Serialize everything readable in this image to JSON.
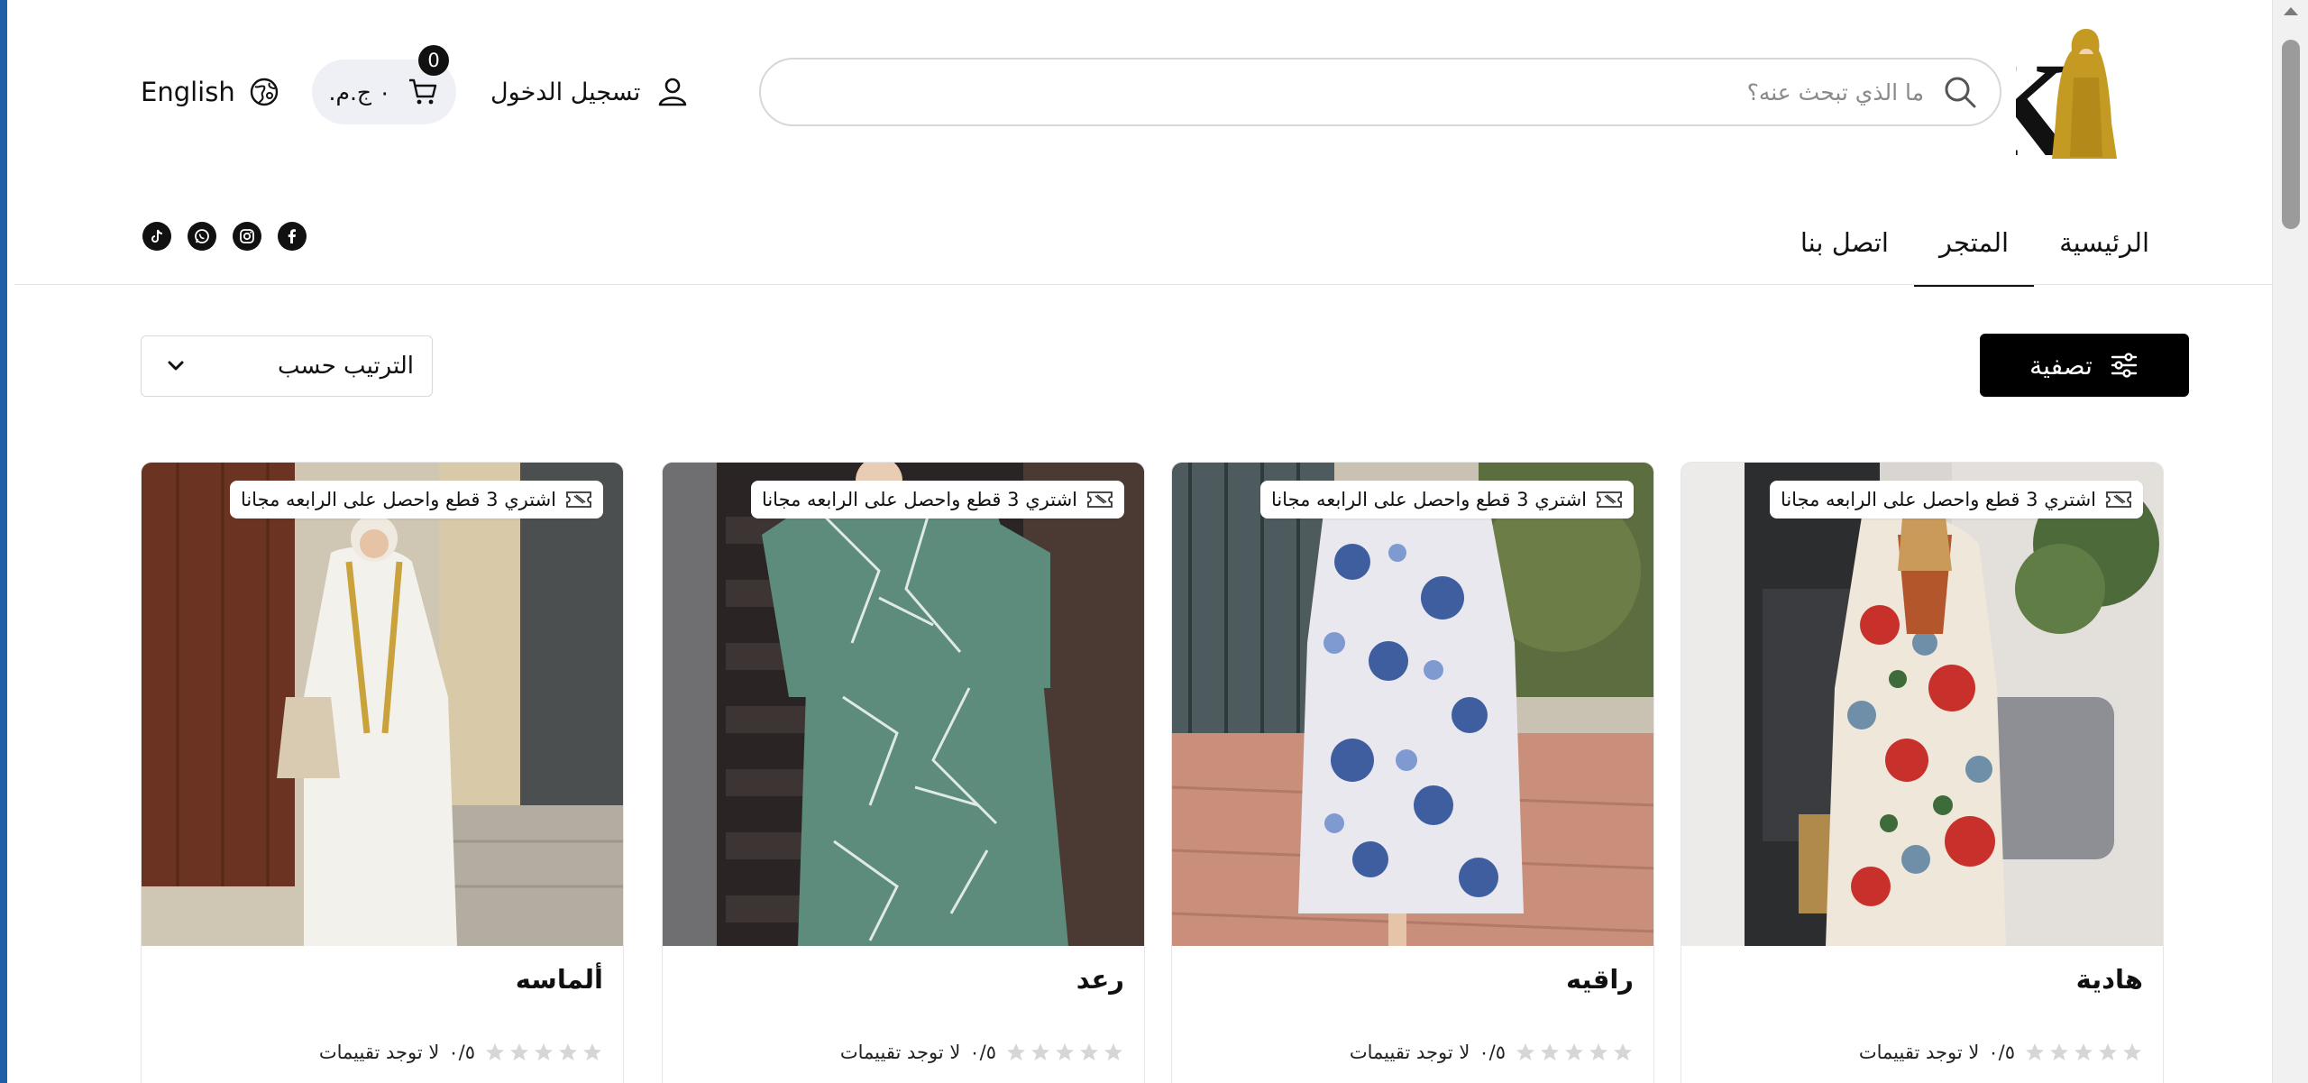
{
  "header": {
    "search_placeholder": "ما الذي تبحث عنه؟",
    "login_label": "تسجيل الدخول",
    "cart_amount": "٠ ج.م.",
    "cart_count": "0",
    "language_label": "English"
  },
  "nav": {
    "tabs": [
      {
        "label": "الرئيسية"
      },
      {
        "label": "المتجر"
      },
      {
        "label": "اتصل بنا"
      }
    ],
    "active_tab": "المتجر",
    "socials": [
      "facebook-icon",
      "instagram-icon",
      "whatsapp-icon",
      "tiktok-icon"
    ]
  },
  "toolbar": {
    "filter_label": "تصفية",
    "sort_label": "الترتيب حسب"
  },
  "products": [
    {
      "name": "هادية",
      "promo": "اشتري 3 قطع واحصل على الرابعه مجانا",
      "rating_value": "٠/٥",
      "rating_text": "لا توجد تقييمات"
    },
    {
      "name": "راقيه",
      "promo": "اشتري 3 قطع واحصل على الرابعه مجانا",
      "rating_value": "٠/٥",
      "rating_text": "لا توجد تقييمات"
    },
    {
      "name": "رعد",
      "promo": "اشتري 3 قطع واحصل على الرابعه مجانا",
      "rating_value": "٠/٥",
      "rating_text": "لا توجد تقييمات"
    },
    {
      "name": "ألماسه",
      "promo": "اشتري 3 قطع واحصل على الرابعه مجانا",
      "rating_value": "٠/٥",
      "rating_text": "لا توجد تقييمات"
    }
  ],
  "colors": {
    "accent": "#000000",
    "window_border": "#1e5fa8",
    "logo_gold": "#c49a22"
  }
}
